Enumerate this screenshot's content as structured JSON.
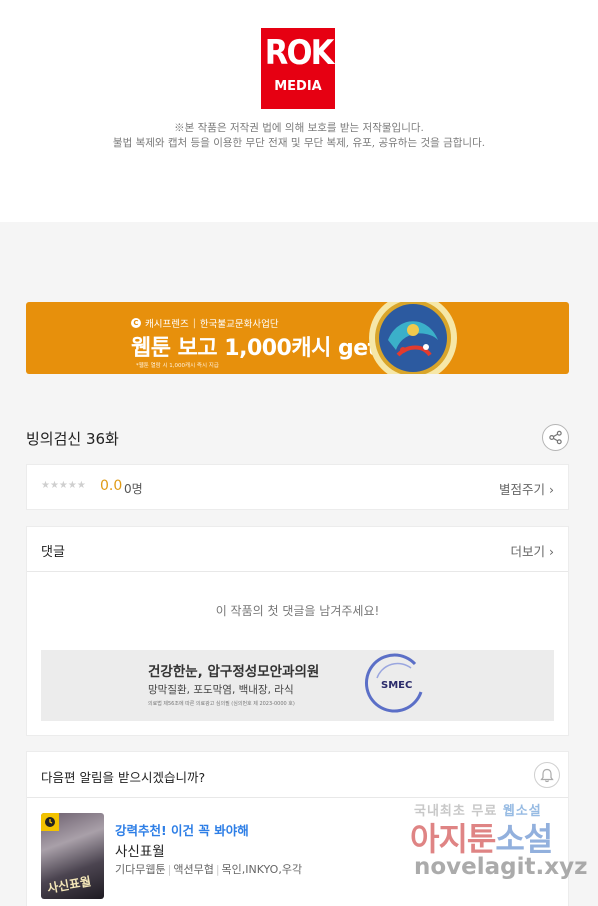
{
  "publisher": {
    "logo_line1": "ROK",
    "logo_line2": "MEDIA",
    "copyright_line1": "※본 작품은 저작권 법에 의해 보호를 받는 저작물입니다.",
    "copyright_line2": "불법 복제와 캡처 등을 이용한 무단 전재 및 무단 복제, 유포, 공유하는 것을 금합니다."
  },
  "banner_ad": {
    "sponsor_brand": "캐시프렌즈",
    "sponsor_separator": "|",
    "sponsor_partner": "한국불교문화사업단",
    "headline": "웹툰 보고 1,000캐시 get!",
    "fine_print": "*웹툰 열람 시 1,000캐시 즉시 지급",
    "brand_color": "#e7900c"
  },
  "episode": {
    "title": "빙의검신 36화"
  },
  "rating": {
    "stars": "★★★★★",
    "score": "0.0",
    "count": "0명",
    "rate_button": "별점주기 ›",
    "score_color": "#e09b16"
  },
  "comments": {
    "label": "댓글",
    "more": "더보기 ›",
    "empty_message": "이 작품의 첫 댓글을 남겨주세요!"
  },
  "clinic_ad": {
    "headline": "건강한눈, 압구정성모안과의원",
    "sub": "망막질환, 포도막염, 백내장, 라식",
    "fine_print": "의료법 제56조에 따른 의료광고 심의필 (심의번호 제 2023-0000 호)",
    "logo_text": "SMEC"
  },
  "notify": {
    "question": "다음편 알림을 받으시겠습니까?"
  },
  "recommendation": {
    "tag": "강력추천! 이건 꼭 봐야해",
    "title": "사신표월",
    "genre": "기다무웹툰",
    "category": "액션무협",
    "authors": "목인,INKYO,우각",
    "thumb_text": "사신표월",
    "tag_color": "#2d7ee6"
  },
  "watermark": {
    "line1_a": "국내최초 무료",
    "line1_b": "웹소설",
    "line2_a": "아지툰",
    "line2_b": "소설",
    "line3": "novelagit.xyz"
  }
}
